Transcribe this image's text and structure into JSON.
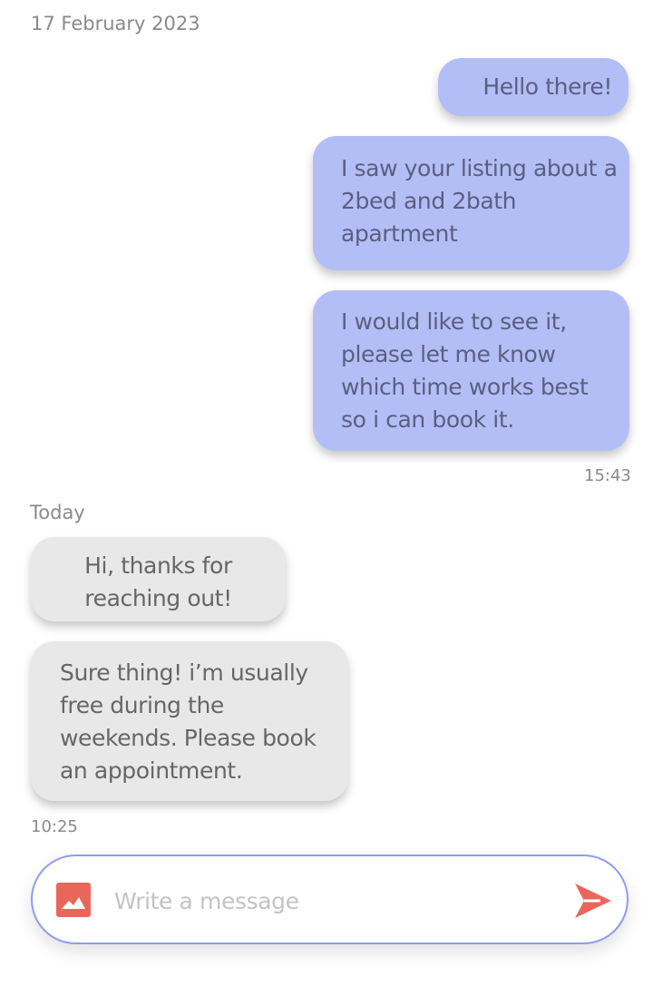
{
  "conversation": {
    "date_label": "17 February 2023",
    "today_label": "Today",
    "messages": [
      {
        "sender": "me",
        "text": "Hello there!"
      },
      {
        "sender": "me",
        "text": "I saw your listing about a 2bed and 2bath apartment"
      },
      {
        "sender": "me",
        "text": "I would like to see it, please let me know which time works best so i can book it."
      },
      {
        "sender": "other",
        "text": "Hi, thanks for reaching out!"
      },
      {
        "sender": "other",
        "text": "Sure thing! i’m usually free during the weekends. Please book an appointment."
      }
    ],
    "sent_time": "15:43",
    "received_time": "10:25"
  },
  "composer": {
    "placeholder": "Write a message",
    "value": "",
    "image_icon": "image-icon",
    "send_icon": "send-icon"
  },
  "colors": {
    "outgoing_bubble": "#b3bef7",
    "incoming_bubble": "#e8e8e8",
    "accent": "#e8675a",
    "input_border": "#8f9cf0"
  }
}
